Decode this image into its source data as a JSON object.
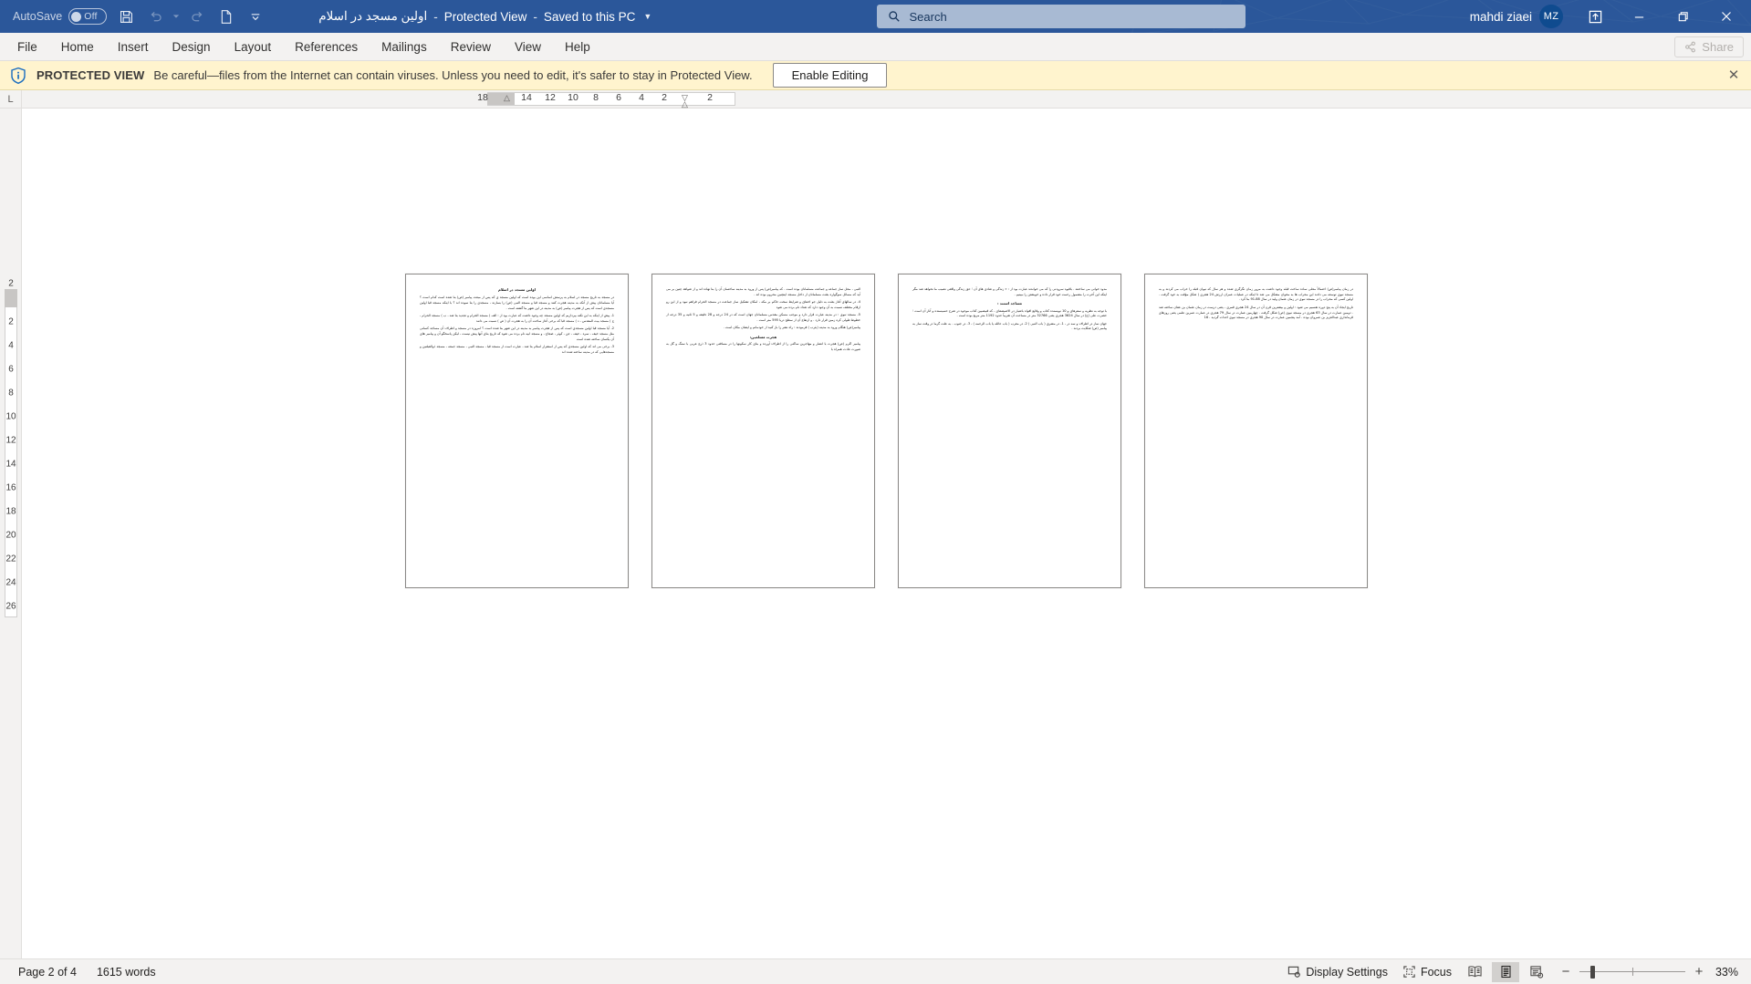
{
  "titlebar": {
    "autosave_label": "AutoSave",
    "autosave_state": "Off",
    "doc_title": "اولین مسجد در اسلام",
    "separator": "-",
    "protected_view_label": "Protected View",
    "saved_location": "Saved to this PC",
    "search_placeholder": "Search",
    "user_name": "mahdi ziaei",
    "user_initials": "MZ",
    "accent_color": "#2B579A",
    "icons": {
      "save": "save-icon",
      "undo": "undo-icon",
      "redo": "redo-icon",
      "document": "document-icon",
      "qat_more": "chevron-down-icon",
      "search": "search-icon",
      "ribbon_display": "ribbon-display-options-icon",
      "minimize": "minimize-icon",
      "restore": "restore-icon",
      "close": "close-icon"
    }
  },
  "ribbon": {
    "tabs": [
      {
        "label": "File"
      },
      {
        "label": "Home"
      },
      {
        "label": "Insert"
      },
      {
        "label": "Design"
      },
      {
        "label": "Layout"
      },
      {
        "label": "References"
      },
      {
        "label": "Mailings"
      },
      {
        "label": "Review"
      },
      {
        "label": "View"
      },
      {
        "label": "Help"
      }
    ],
    "share_label": "Share"
  },
  "protected_view": {
    "badge": "PROTECTED VIEW",
    "message": "Be careful—files from the Internet can contain viruses. Unless you need to edit, it's safer to stay in Protected View.",
    "button_label": "Enable Editing",
    "close_glyph": "✕",
    "background_color": "#FFF4CE",
    "icon": "shield-info-icon"
  },
  "ruler": {
    "tabstop_glyph": "L",
    "horizontal_numbers": [
      "18",
      "14",
      "12",
      "10",
      "8",
      "6",
      "4",
      "2",
      "2"
    ],
    "vertical_numbers": [
      "2",
      "2",
      "4",
      "6",
      "8",
      "10",
      "12",
      "14",
      "16",
      "18",
      "20",
      "22",
      "24",
      "26"
    ]
  },
  "document": {
    "pages": [
      {
        "title": "اولین مسجد در اسلام",
        "body": "در مسجد به تاریخ مسجد در اسلام به پرسش اساسی این بوده است که اولین مسجد ی که پس از مبعث پیامبر (ص) بنا شده است کدام است ؟ آیا مسلمانان پیش از آنکه به مدینه هجرت کنند و مسجد قبا و مسجد النبی (ص) را بسازند ، مسجدی را بنا نموده اند ؟ با اینکه مسجد قبا اولین مسجدی است که پس از هجرت پیامبر (ص) به مدینه در این شهر بنا گشته است .",
        "paragraphs": [
          "1- پیش از اینکه به این نکته بپردازیم که اولین مسجد چه وجود داشت که عبارت بود از : الف ) مسجد الحرام و تجدید بنا شد ، ب ) مسجد الحرام ، ج ) مسجد بیت المقدس ، د ) مسجد قبا که برخی آغاز ساخت آن را به هجرت آن ( ص ) نسبت می دانند",
          "2- آیا مسجد قبا اولین مسجدی است که پس از هجرت پیامبر به مدینه در این شهر بنا شده است ؟ امروزه در مسجد و اطراف آن مساجد کسانی مثل مسجد خیف ، نمره ، خیف ، جن ، کوثر ، ضجاج ، و مسجد ابیه نام برده می شود که تاریخ بنای آنها پیش نیست ، لیکن پاسخگو آن و پیامبر های آن یکسان ساخته شده است",
          "3- برخی می اند که اولین مسجدی که پس از استقرار اسلام بنا شد ، عبارت است از مسجد قبا ، مسجد النبی ، مسجد جمعه ، مسجد ذوالقبلتین و مسجدهایی که در مدینه ساخته شده اند"
        ]
      },
      {
        "body": "النبی ، محل نماز جماعه و جماعت مسلمانان بوده است . که پیامبر(ص) پس از ورود به مدینه ساختمان آن را بنا نهاده اند و از شواهد چنین بر می آید که مسائل سوگواره بعثت مسلمانان از داخل مسجد اینچنین محروم بوده اند .",
        "paragraphs": [
          "4- در سالهای آغاز بعثت به دلیل جو اختناق و شرایط سخت حاکم بر مکه ، امکان تشکیل نماز جماعت در مسجد الحرام فراهم نبود و از این رو ارقام مختلف نسبت به آن وجود دارد که تعداد نام برده می شود",
          "5- مسجد نبوی : در مدینه عبارت قرار دارد و موجب مسکن مقدس مسلمانان جهان است که در 24 درجه و 28 دقیقه و 5 ثانیه و 35 درجه از خطوط طولی کره زمین قرار دارد . و ارتفاع آن از سطح دریا 595 متر است .",
          "پیامبر(ص) هنگام ورود به مدینه (یثرب ) فرمودند : راه نشر را باز کنید از خودمانم و ایشان مکان است ."
        ],
        "subtitle": "هجرت مسلمین:",
        "closing": "پیامبر اکرم (ص) هجرت با انصار و مهاجرین ساکنی را از اطراف آورده و بنای کار سکونها را در مسافتی حدود 3 ذرع عربی با سنگ و گل به صورت عادت همراه با"
      },
      {
        "body": "مدود خوانی می ساختند . باقیود سرودنی را که می خواندند عبارت بود از : « زندگی و شادی های آن ؛ حق زندگی واقعی نصیب ما نخواهد شد مگر اینکه این آخرت را مشمول رحمت خود قرار داده و خویشتن را ببینیم .",
        "subtitle": "مساجد استند :",
        "paragraphs": [
          "با توجه به نظریه و سفرهای و 10 نویسنده کتاب و وقایع افواه باشیار در الاصیصفای ، که قبیصیین کتاب موجود در شرح حسیسنده و آثار آن است ؛ حضرت علی (ع) در سال 3624 هجری یعنی 32766 متر در مساحت آن تقریباً حدود 1192 متر مربع بوده است .",
          "جهان نماز در اطراف و سه در ، 1- در مشرق ( باب النبی ) 2- در مغرب ( باب حائله یا باب الرحمه ) ، 3- در جنوب . به علت گرما در وقت نماز به پیامبر (ص) شکایت بردند ."
        ]
      },
      {
        "body": "در زمان پیامبر(ص) احتمالاً محلی ساده ساخت قبله وجود داشت به مرور زمان نگرگری شده و هر سال که نیوان قبله را خراب می کردند و به مسجد نبوی توسعه می دادند این محراب ها به مخوان مشکل می شد تا اینکه در عملیات عمران ارزش 24 هجری (  شکل مؤقت به خود گرفت . اولین کسی که محراب را در مسجد نبوی در زمان عثمان ولید در سال 88-91 بنا کرد .",
        "paragraphs": [
          "تاریخ ایجاد آن به پنج دوره تقسیم می شود : اولین و بیشترین قرن آن در سال 24 هجری قمری ، یعنی درست در زمان عثمان بن عفان ساخته شد . دومین عمارت در سال 63 هجری در مسجد نبوی (ص) شکل گرفت . چهارمین عمارت در سال 79 هجری در عمارت عمرین علمی یعنی روزهای قرمانداری عبدالعزیز بن عمروان بوده . آمد پنجمین عمارت در سال 90 هجری در مسجد نبوی احداث گردید . 16"
        ]
      }
    ]
  },
  "statusbar": {
    "page_status": "Page 2 of 4",
    "word_count": "1615 words",
    "display_settings_label": "Display Settings",
    "focus_label": "Focus",
    "zoom_level": "33%",
    "zoom_out_glyph": "−",
    "zoom_in_glyph": "+",
    "view_modes": [
      "read-mode",
      "print-layout",
      "web-layout"
    ],
    "active_view_mode": "print-layout"
  }
}
